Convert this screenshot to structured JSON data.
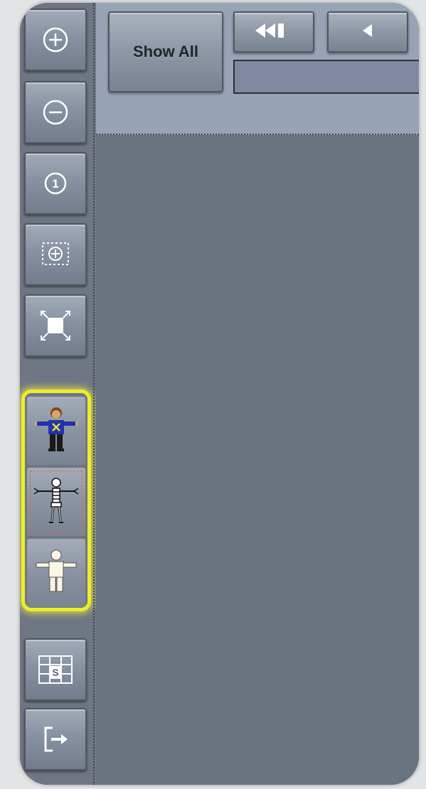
{
  "app": {
    "left_toolbar": {
      "buttons": [
        {
          "id": "zoom-in",
          "icon": "plus-circle-icon"
        },
        {
          "id": "zoom-out",
          "icon": "minus-circle-icon"
        },
        {
          "id": "zoom-actual",
          "icon": "one-circle-icon",
          "glyph": "1"
        },
        {
          "id": "zoom-selection",
          "icon": "zoom-selection-icon"
        },
        {
          "id": "fit-screen",
          "icon": "fit-arrows-icon"
        }
      ],
      "avatar_modes": [
        {
          "id": "skin",
          "icon": "character-clothed-icon",
          "selected": false
        },
        {
          "id": "skeleton",
          "icon": "skeleton-icon",
          "selected": true
        },
        {
          "id": "mesh",
          "icon": "character-mesh-icon",
          "selected": false
        }
      ],
      "bottom_buttons": [
        {
          "id": "layout",
          "icon": "grid-layout-icon",
          "glyph": "S"
        },
        {
          "id": "exit",
          "icon": "exit-icon"
        }
      ]
    },
    "top_toolbar": {
      "show_all_label": "Show All",
      "nav_buttons": [
        {
          "id": "first",
          "icon": "rewind-to-start-icon"
        },
        {
          "id": "previous",
          "icon": "step-back-icon"
        }
      ],
      "frame_field_value": ""
    },
    "colors": {
      "highlight": "#ecee2a",
      "canvas": "#6b7280",
      "topbar": "#98a3b6"
    }
  }
}
